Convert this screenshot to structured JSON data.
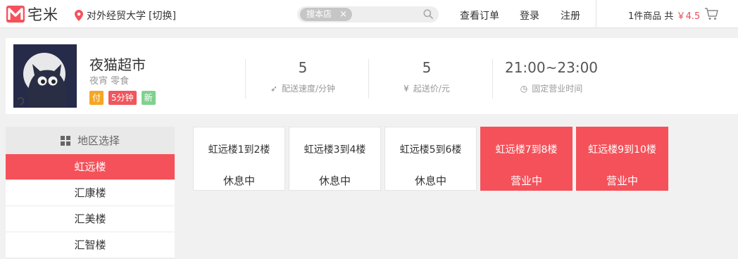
{
  "header": {
    "logo_text": "宅米",
    "location": "对外经贸大学",
    "location_switch": "[切换]",
    "search": {
      "chip": "搜本店",
      "chip_close": "×",
      "placeholder": ""
    },
    "nav": {
      "orders": "查看订单",
      "login": "登录",
      "register": "注册"
    },
    "cart": {
      "prefix": "1件商品 共",
      "currency": "￥",
      "amount": "4.5"
    }
  },
  "store": {
    "name": "夜猫超市",
    "tags": "夜宵 零食",
    "badges": {
      "pay": "付",
      "delivery_time": "5分钟",
      "new": "新"
    },
    "stats": [
      {
        "value": "5",
        "icon": "rocket-icon",
        "label": "配送速度/分钟"
      },
      {
        "value": "5",
        "icon": "yen-icon",
        "label": "起送价/元"
      },
      {
        "value": "21:00~23:00",
        "icon": "clock-icon",
        "label": "固定营业时间"
      }
    ]
  },
  "sidebar": {
    "title": "地区选择",
    "zones": [
      {
        "label": "虹远楼",
        "active": true
      },
      {
        "label": "汇康楼",
        "active": false
      },
      {
        "label": "汇美楼",
        "active": false
      },
      {
        "label": "汇智楼",
        "active": false
      }
    ]
  },
  "floors": [
    {
      "name": "虹远楼1到2楼",
      "status": "休息中",
      "open": false
    },
    {
      "name": "虹远楼3到4楼",
      "status": "休息中",
      "open": false
    },
    {
      "name": "虹远楼5到6楼",
      "status": "休息中",
      "open": false
    },
    {
      "name": "虹远楼7到8楼",
      "status": "营业中",
      "open": true
    },
    {
      "name": "虹远楼9到10楼",
      "status": "营业中",
      "open": true
    }
  ],
  "colors": {
    "accent": "#f5515a",
    "price": "#e84e55",
    "badge_pay": "#f5a623",
    "badge_new": "#7fd28e"
  }
}
